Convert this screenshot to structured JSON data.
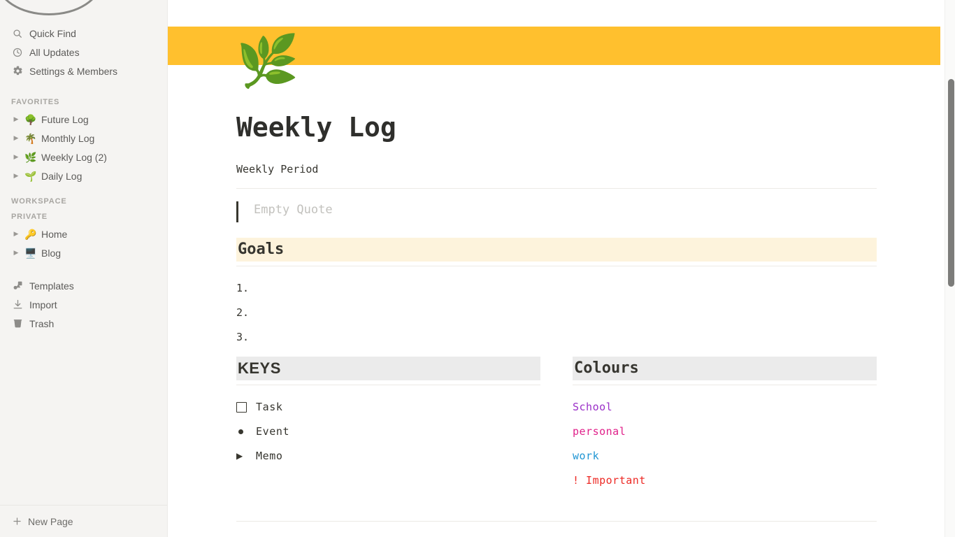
{
  "sidebar": {
    "top_items": [
      {
        "label": "Quick Find",
        "icon": "search-icon"
      },
      {
        "label": "All Updates",
        "icon": "clock-icon"
      },
      {
        "label": "Settings & Members",
        "icon": "gear-icon"
      }
    ],
    "favorites_header": "FAVORITES",
    "favorites": [
      {
        "label": "Future Log",
        "emoji": "🌳",
        "arrow": "▶"
      },
      {
        "label": "Monthly Log",
        "emoji": "🌴",
        "arrow": "▶"
      },
      {
        "label": "Weekly Log (2)",
        "emoji": "🌿",
        "arrow": "▶"
      },
      {
        "label": "Daily Log",
        "emoji": "🌱",
        "arrow": "▶"
      }
    ],
    "workspace_header": "WORKSPACE",
    "private_header": "PRIVATE",
    "private": [
      {
        "label": "Home",
        "emoji": "🔑",
        "arrow": "▶"
      },
      {
        "label": "Blog",
        "emoji": "🖥️",
        "arrow": "▶"
      }
    ],
    "tools": [
      {
        "label": "Templates",
        "icon": "templates-icon"
      },
      {
        "label": "Import",
        "icon": "import-icon"
      },
      {
        "label": "Trash",
        "icon": "trash-icon"
      }
    ],
    "new_page": {
      "label": "New Page",
      "icon": "plus-icon"
    }
  },
  "page": {
    "cover_color": "#ffc02e",
    "emoji": "🌿",
    "title": "Weekly Log",
    "period_label": "Weekly Period",
    "quote_placeholder": "Empty Quote",
    "goals": {
      "heading": "Goals",
      "highlight_color": "#fdf3dc",
      "items": [
        "1.",
        "2.",
        "3."
      ]
    },
    "keys": {
      "heading": "KEYS",
      "highlight_color": "#ebebeb",
      "items": [
        {
          "glyph": "checkbox",
          "label": "Task"
        },
        {
          "glyph": "bullet",
          "label": "Event"
        },
        {
          "glyph": "triangle",
          "label": "Memo"
        }
      ]
    },
    "colours": {
      "heading": "Colours",
      "highlight_color": "#ebebeb",
      "items": [
        {
          "label": "School",
          "color": "#9b30c8"
        },
        {
          "label": "personal",
          "color": "#e0218a"
        },
        {
          "label": "work",
          "color": "#2196d4"
        },
        {
          "label": "! Important",
          "color": "#ed2a25"
        }
      ]
    }
  },
  "scrollbar": {
    "thumb_color": "#7c7c7a"
  }
}
